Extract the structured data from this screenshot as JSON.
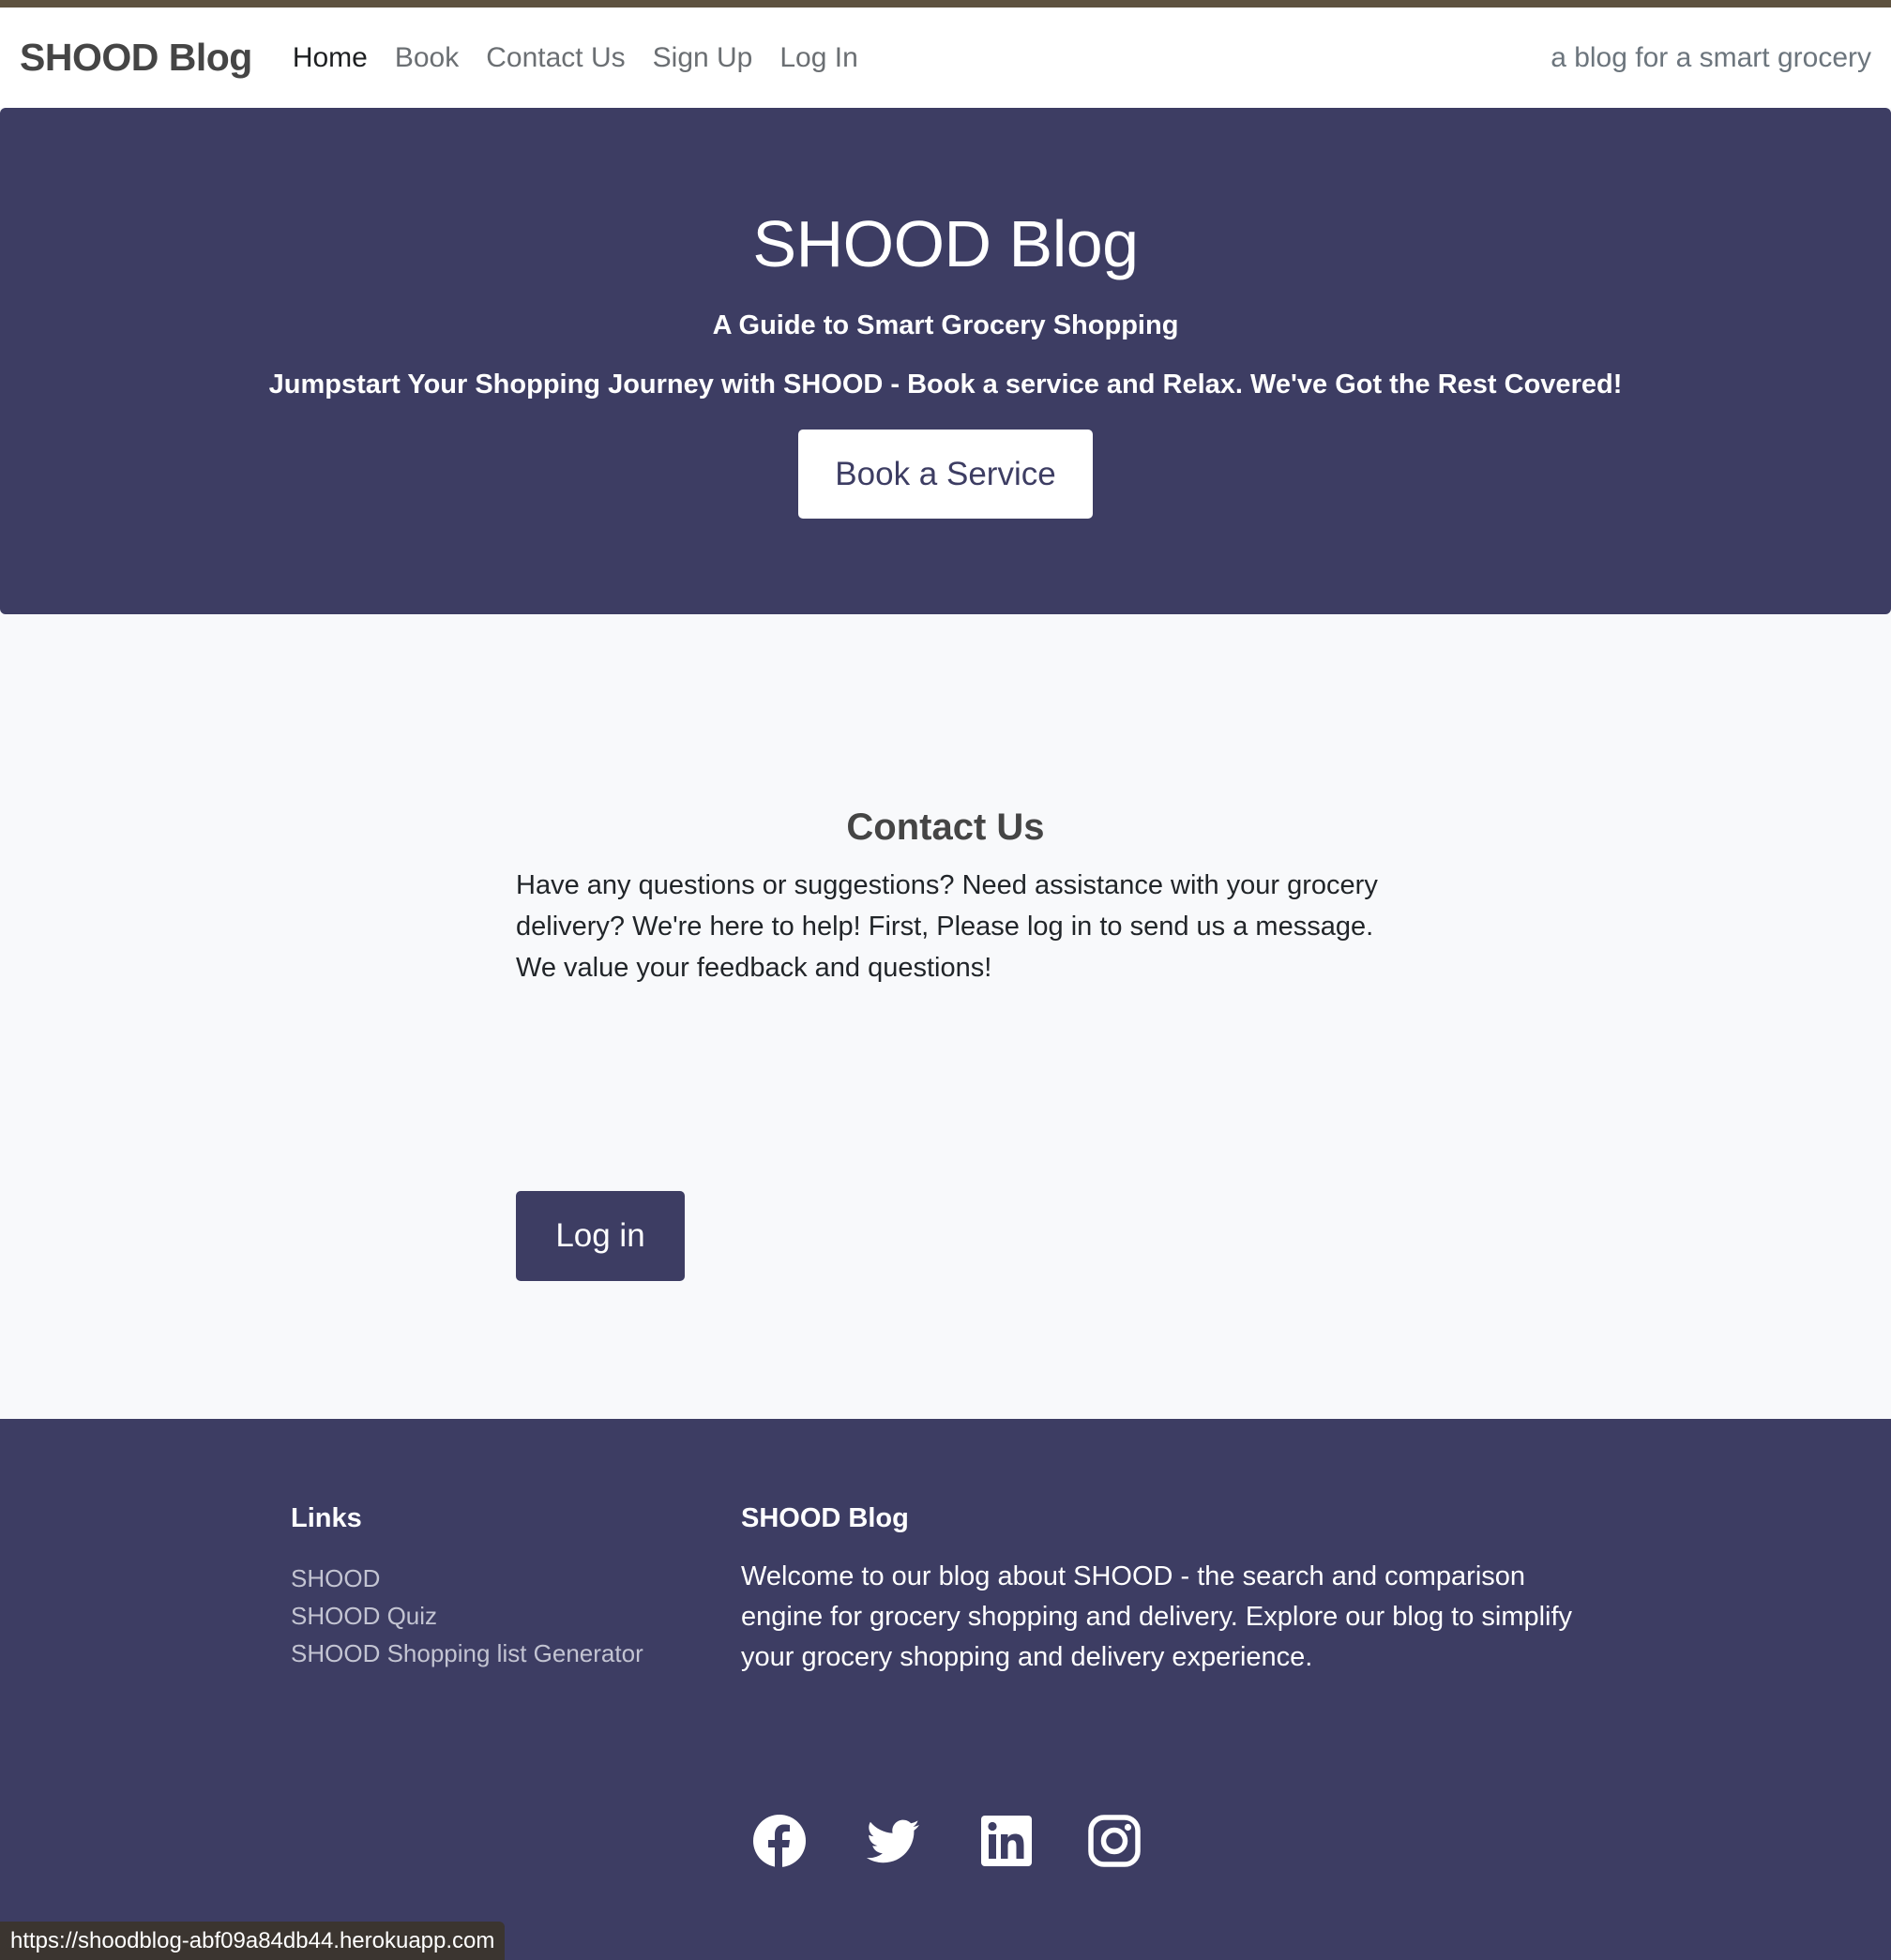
{
  "navbar": {
    "brand": "SHOOD Blog",
    "links": [
      "Home",
      "Book",
      "Contact Us",
      "Sign Up",
      "Log In"
    ],
    "tagline": "a blog for a smart grocery"
  },
  "hero": {
    "title": "SHOOD Blog",
    "subtitle": "A Guide to Smart Grocery Shopping",
    "lead": "Jumpstart Your Shopping Journey with SHOOD - Book a service and Relax. We've Got the Rest Covered!",
    "button": "Book a Service"
  },
  "contact": {
    "title": "Contact Us",
    "text": "Have any questions or suggestions? Need assistance with your grocery delivery? We're here to help! First, Please log in to send us a message. We value your feedback and questions!",
    "login_button": "Log in"
  },
  "footer": {
    "links_heading": "Links",
    "links": [
      "SHOOD",
      "SHOOD Quiz",
      "SHOOD Shopping list Generator"
    ],
    "about_heading": "SHOOD Blog",
    "about_text": "Welcome to our blog about SHOOD - the search and comparison engine for grocery shopping and delivery. Explore our blog to simplify your grocery shopping and delivery experience.",
    "social_icons": [
      "facebook-icon",
      "twitter-icon",
      "linkedin-icon",
      "instagram-icon"
    ]
  },
  "status_bar": {
    "url": "https://shoodblog-abf09a84db44.herokuapp.com"
  },
  "colors": {
    "primary": "#3d3d63",
    "background": "#f8f9fb",
    "navbar": "#ffffff"
  }
}
